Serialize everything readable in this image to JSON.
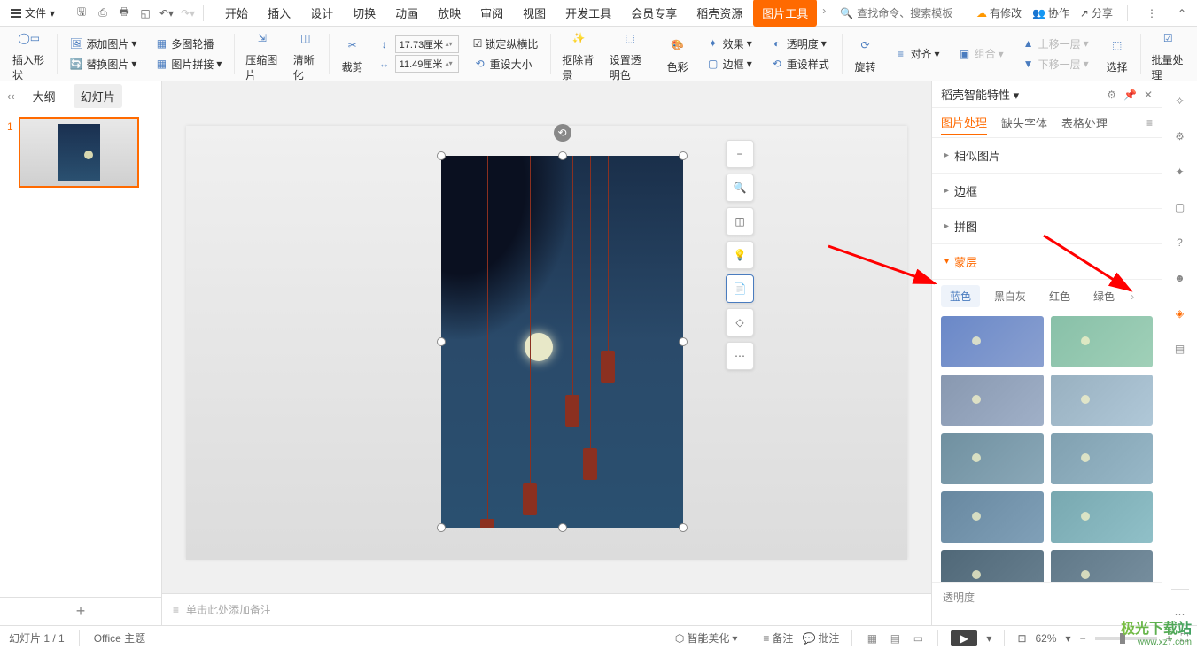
{
  "menubar": {
    "file": "文件",
    "tabs": [
      "开始",
      "插入",
      "设计",
      "切换",
      "动画",
      "放映",
      "审阅",
      "视图",
      "开发工具",
      "会员专享",
      "稻壳资源",
      "图片工具"
    ],
    "active_tab_index": 11,
    "search_placeholder": "查找命令、搜索模板",
    "right": {
      "unsaved": "有修改",
      "collab": "协作",
      "share": "分享"
    }
  },
  "ribbon": {
    "insert_shape": "插入形状",
    "add_image": "添加图片",
    "multi_carousel": "多图轮播",
    "replace_image": "替换图片",
    "image_collage": "图片拼接",
    "compress": "压缩图片",
    "sharpen": "清晰化",
    "crop": "裁剪",
    "width": "17.73厘米",
    "height": "11.49厘米",
    "lock_ratio": "锁定纵横比",
    "reset_size": "重设大小",
    "remove_bg": "抠除背景",
    "set_transparent": "设置透明色",
    "recolor": "色彩",
    "effects": "效果",
    "transparency": "透明度",
    "border": "边框",
    "reset_style": "重设样式",
    "rotate": "旋转",
    "align": "对齐",
    "group": "组合",
    "bring_forward": "上移一层",
    "send_backward": "下移一层",
    "select": "选择",
    "batch": "批量处理"
  },
  "slide_panel": {
    "outline": "大纲",
    "slides": "幻灯片",
    "slide_num": "1"
  },
  "notes": {
    "placeholder": "单击此处添加备注"
  },
  "right_panel": {
    "title": "稻壳智能特性",
    "tabs": {
      "image": "图片处理",
      "missing_fonts": "缺失字体",
      "table": "表格处理"
    },
    "sections": {
      "similar": "相似图片",
      "border": "边框",
      "collage": "拼图",
      "mask": "蒙层"
    },
    "color_tabs": [
      "蓝色",
      "黑白灰",
      "红色",
      "绿色"
    ],
    "footer": "透明度"
  },
  "status": {
    "slide_count": "幻灯片 1 / 1",
    "theme": "Office 主题",
    "beautify": "智能美化",
    "notes": "备注",
    "comments": "批注",
    "zoom": "62%"
  }
}
